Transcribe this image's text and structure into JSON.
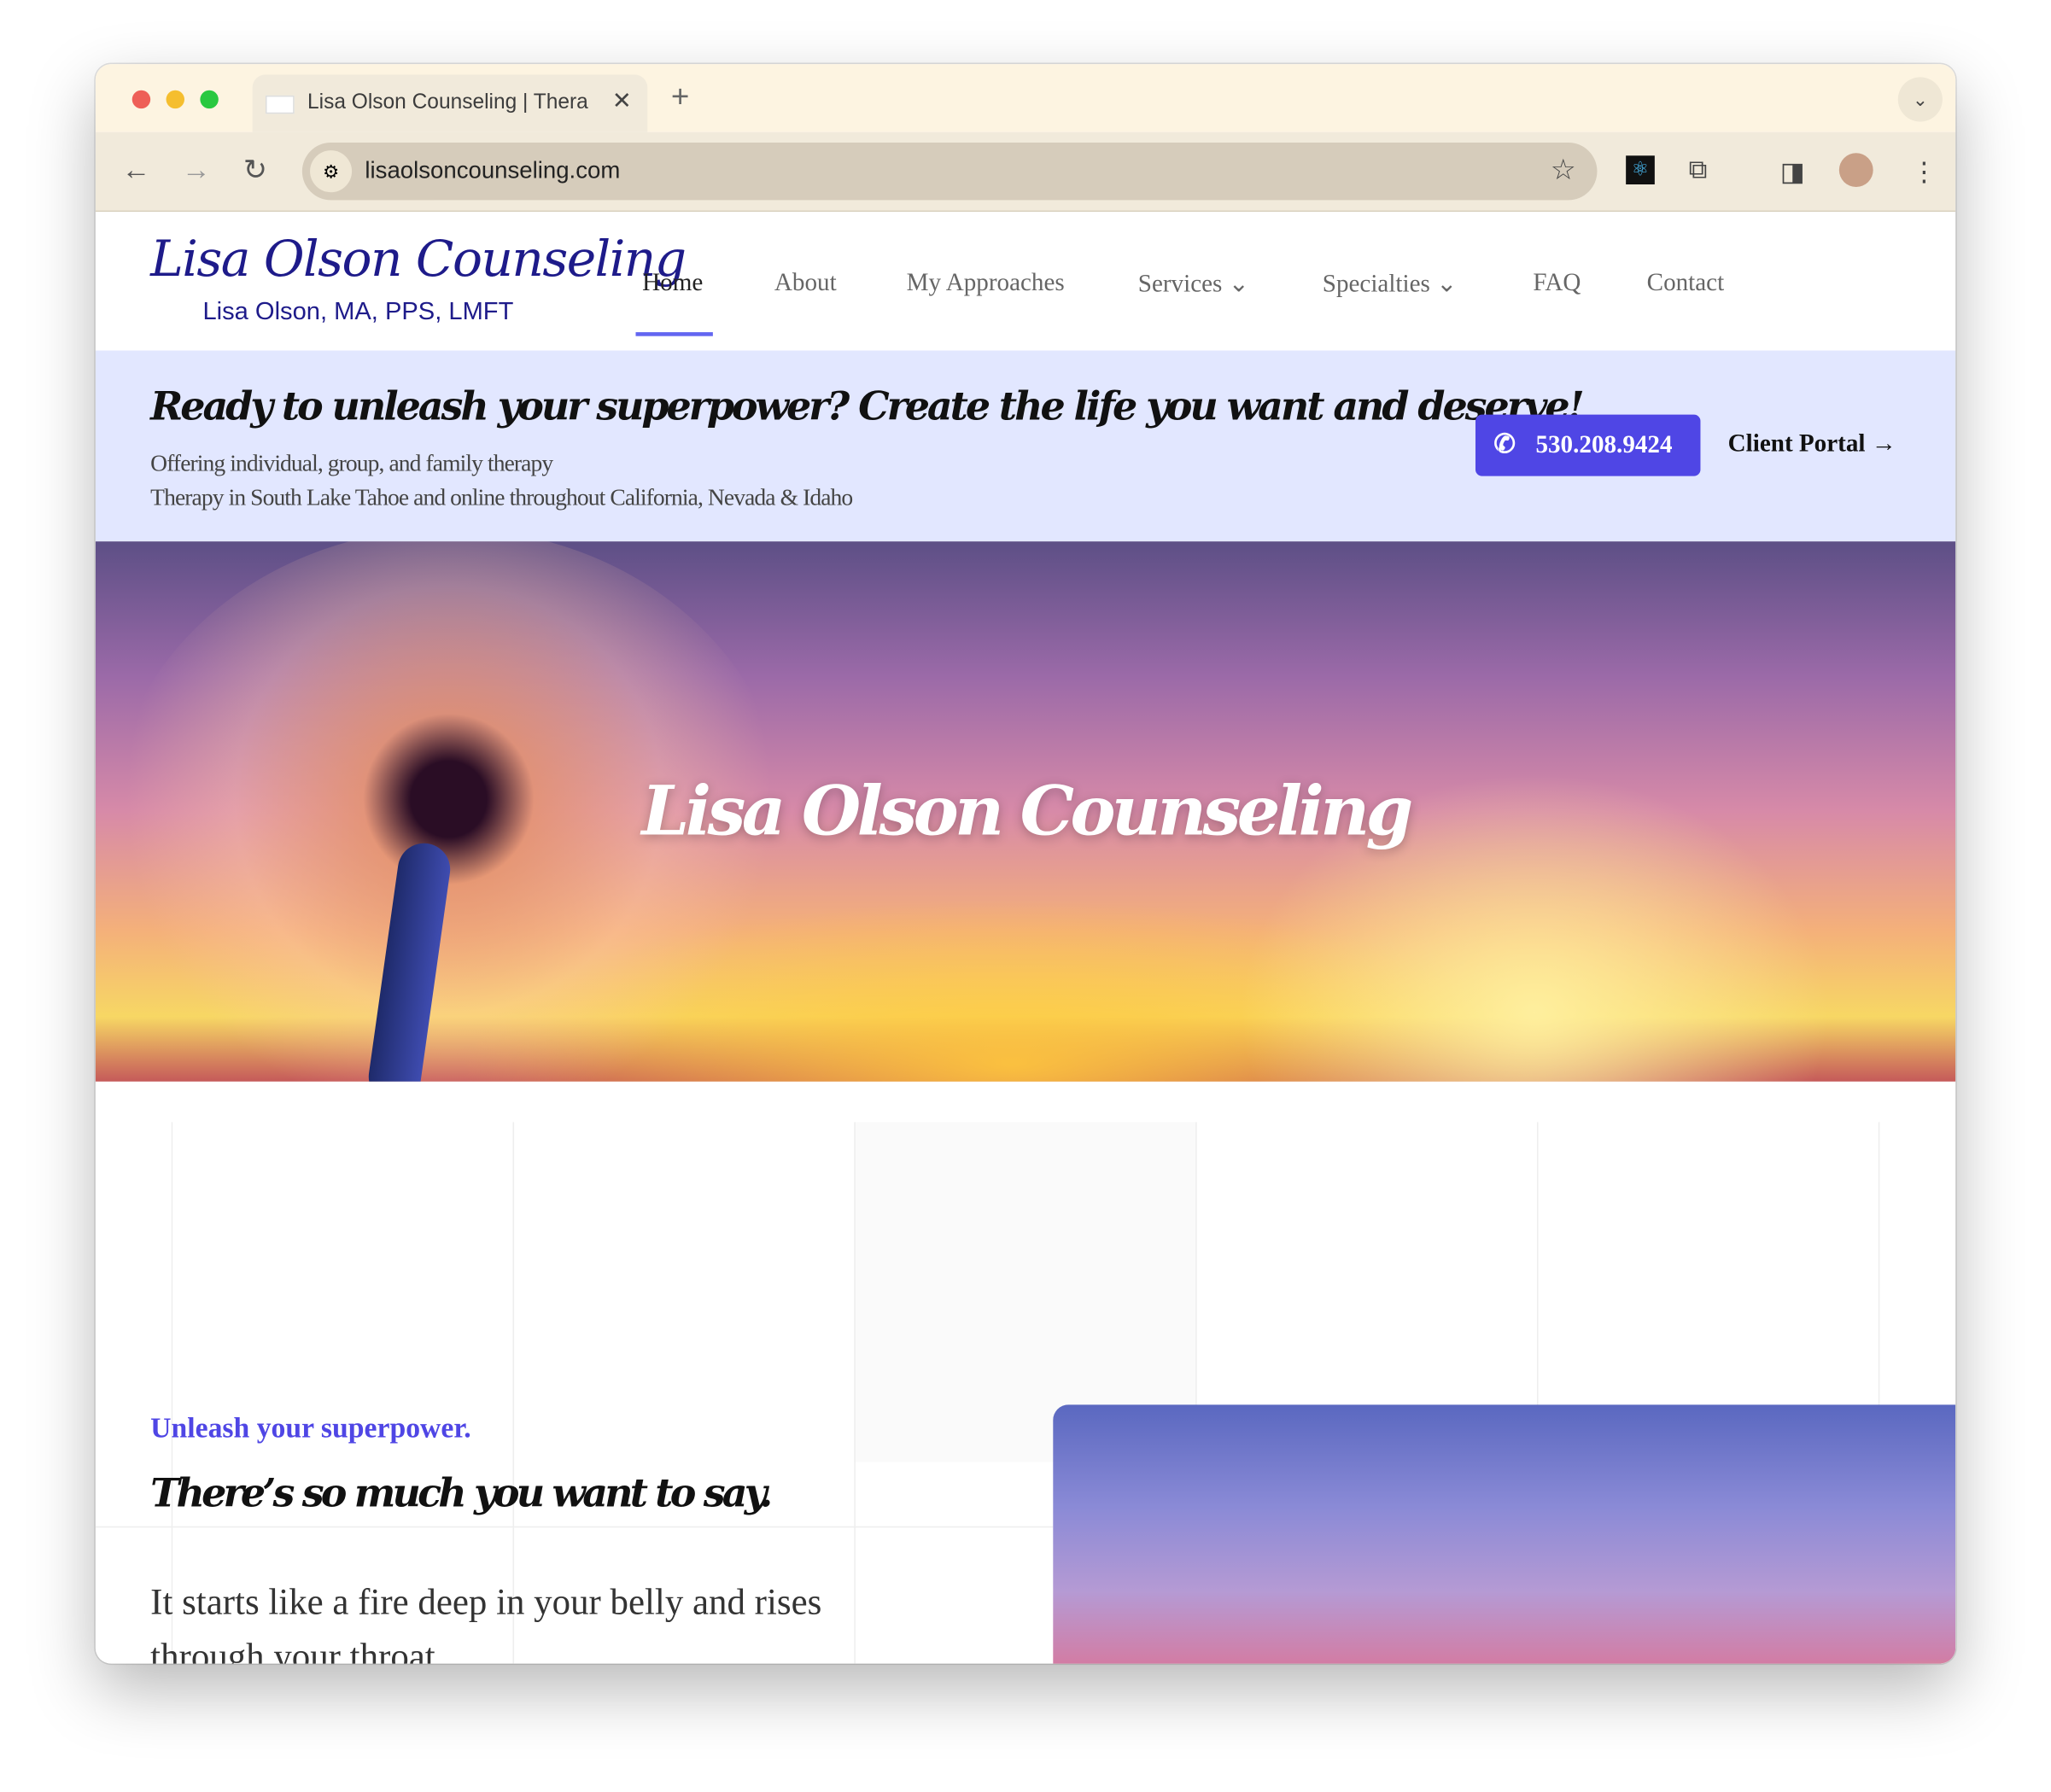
{
  "browser": {
    "tab_title": "Lisa Olson Counseling | Thera",
    "url": "lisaolsoncounseling.com"
  },
  "site": {
    "logo": "Lisa Olson Counseling",
    "logo_sub": "Lisa Olson, MA, PPS, LMFT",
    "nav": [
      {
        "label": "Home",
        "active": true
      },
      {
        "label": "About"
      },
      {
        "label": "My Approaches"
      },
      {
        "label": "Services",
        "dropdown": true
      },
      {
        "label": "Specialties",
        "dropdown": true
      },
      {
        "label": "FAQ"
      },
      {
        "label": "Contact"
      }
    ]
  },
  "banner": {
    "tagline": "Ready to unleash your superpower? Create the life you want and deserve!",
    "line1": "Offering individual, group, and family therapy",
    "line2": "Therapy in South Lake Tahoe and online throughout California, Nevada & Idaho",
    "phone": "530.208.9424",
    "portal": "Client Portal →"
  },
  "hero": {
    "title": "Lisa Olson Counseling"
  },
  "intro": {
    "eyebrow": "Unleash your superpower.",
    "heading": "There’s so much you want to say.",
    "paragraph": "It starts like a fire deep in your belly and rises through your throat."
  },
  "colors": {
    "accent": "#4f46e5",
    "logo": "#1e1b8a",
    "banner_bg": "#e2e7ff"
  }
}
